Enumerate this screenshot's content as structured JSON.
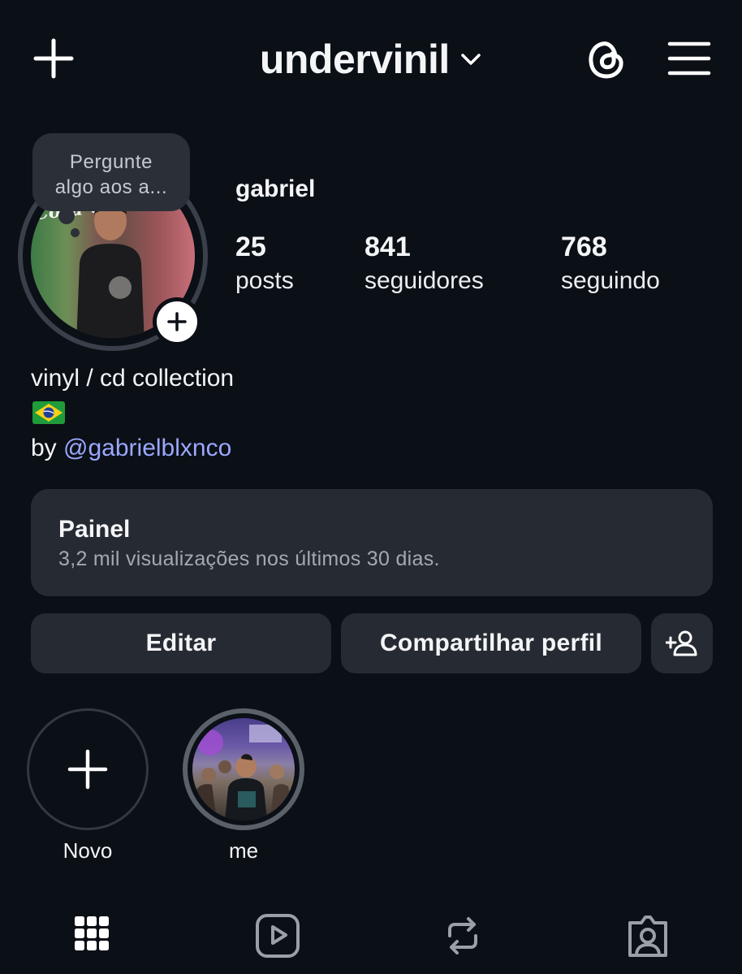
{
  "header": {
    "username": "undervinil",
    "icons": [
      "plus-icon",
      "chevron-down-icon",
      "threads-icon",
      "hamburger-menu-icon"
    ]
  },
  "note": {
    "line1": "Pergunte",
    "line2": "algo aos a..."
  },
  "profile": {
    "name": "gabriel",
    "stats": [
      {
        "value": "25",
        "label": "posts"
      },
      {
        "value": "841",
        "label": "seguidores"
      },
      {
        "value": "768",
        "label": "seguindo"
      }
    ]
  },
  "bio": {
    "line1": "vinyl / cd collection",
    "flag": "flag-brazil",
    "by_prefix": "by ",
    "mention": "@gabrielblxnco"
  },
  "dashboard": {
    "title": "Painel",
    "subtitle": "3,2 mil visualizações nos últimos 30 dias."
  },
  "actions": {
    "edit_label": "Editar",
    "share_label": "Compartilhar perfil",
    "add_person_icon": "add-person-icon"
  },
  "highlights": [
    {
      "label": "Novo"
    },
    {
      "label": "me"
    }
  ],
  "tabs": [
    "grid-icon",
    "reels-icon",
    "reposts-icon",
    "tagged-icon"
  ],
  "colors": {
    "background": "#0b0f16",
    "card": "#262b33",
    "mention": "#9aa8ff",
    "secondary_text": "#a4a9b1"
  }
}
